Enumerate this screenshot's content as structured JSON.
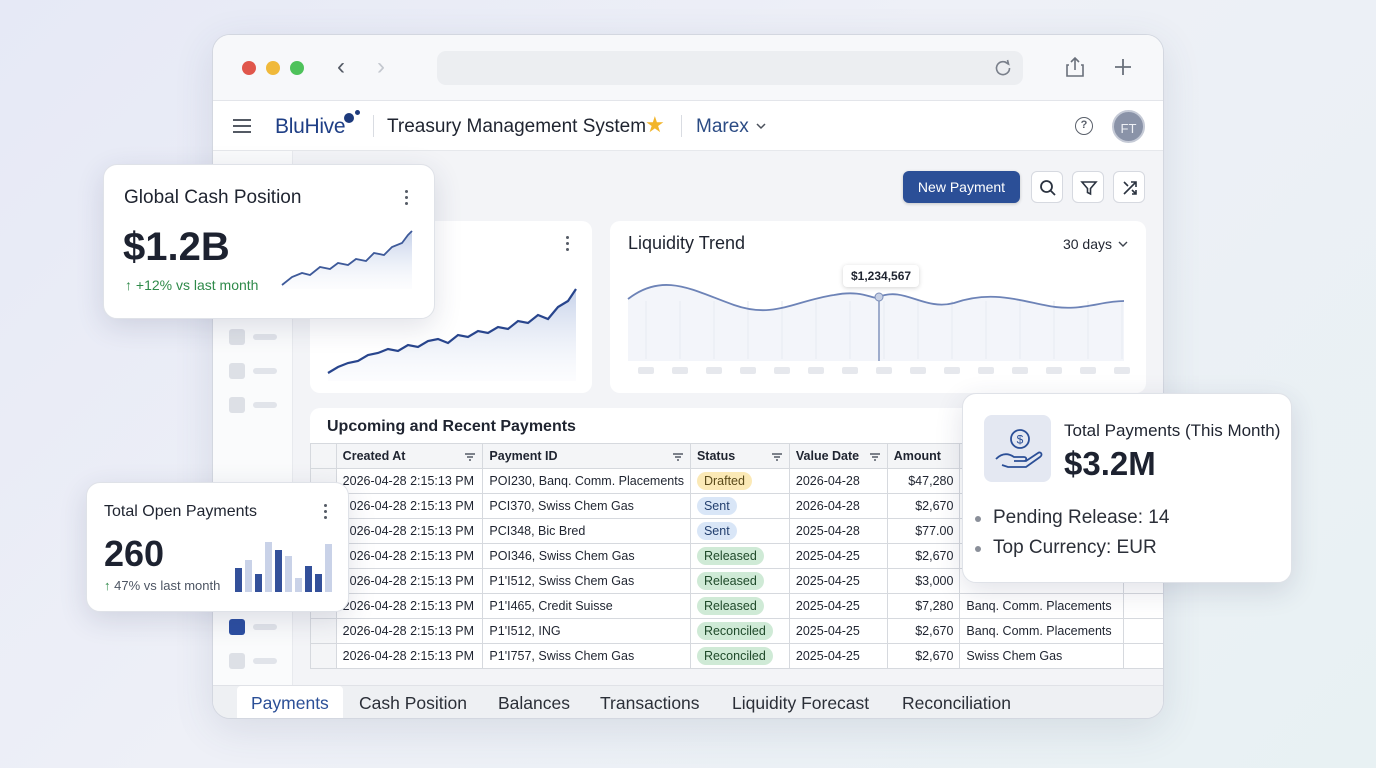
{
  "app": {
    "brand": "BluHive",
    "title": "Treasury Management System",
    "entity": "Marex",
    "avatar_initials": "FT",
    "help_glyph": "?"
  },
  "toolbar": {
    "new_payment_label": "New Payment"
  },
  "liquidity": {
    "title": "Liquidity Trend",
    "range": "30 days",
    "tooltip": "$1,234,567"
  },
  "table": {
    "title": "Upcoming and Recent Payments",
    "columns": [
      "Created At",
      "Payment ID",
      "Status",
      "Value Date",
      "Amount"
    ],
    "rows": [
      {
        "created": "2026-04-28 2:15:13 PM",
        "id": "POI230, Banq. Comm. Placements",
        "status": "Drafted",
        "value_date": "2026-04-28",
        "amount": "$47,280",
        "extra": ""
      },
      {
        "created": "2026-04-28 2:15:13 PM",
        "id": "PCI370, Swiss Chem Gas",
        "status": "Sent",
        "value_date": "2026-04-28",
        "amount": "$2,670",
        "extra": ""
      },
      {
        "created": "2026-04-28 2:15:13 PM",
        "id": "PCI348, Bic Bred",
        "status": "Sent",
        "value_date": "2025-04-28",
        "amount": "$77.00",
        "extra": ""
      },
      {
        "created": "2026-04-28 2:15:13 PM",
        "id": "POI346, Swiss Chem Gas",
        "status": "Released",
        "value_date": "2025-04-25",
        "amount": "$2,670",
        "extra": ""
      },
      {
        "created": "2026-04-28 2:15:13 PM",
        "id": "P1'I512, Swiss Chem Gas",
        "status": "Released",
        "value_date": "2025-04-25",
        "amount": "$3,000",
        "extra": ""
      },
      {
        "created": "2026-04-28 2:15:13 PM",
        "id": "P1'I465, Credit Suisse",
        "status": "Released",
        "value_date": "2025-04-25",
        "amount": "$7,280",
        "extra": "Banq. Comm. Placements"
      },
      {
        "created": "2026-04-28 2:15:13 PM",
        "id": "P1'I512, ING",
        "status": "Reconciled",
        "value_date": "2025-04-25",
        "amount": "$2,670",
        "extra": "Banq. Comm. Placements"
      },
      {
        "created": "2026-04-28 2:15:13 PM",
        "id": "P1'I757, Swiss Chem Gas",
        "status": "Reconciled",
        "value_date": "2025-04-25",
        "amount": "$2,670",
        "extra": "Swiss Chem Gas"
      }
    ]
  },
  "tabs": [
    "Payments",
    "Cash Position",
    "Balances",
    "Transactions",
    "Liquidity Forecast",
    "Reconciliation"
  ],
  "cash_card": {
    "title": "Global Cash Position",
    "value": "$1.2B",
    "delta": "+12% vs last month"
  },
  "open_card": {
    "title": "Total Open Payments",
    "value": "260",
    "delta": "47% vs last month"
  },
  "total_card": {
    "title": "Total Payments (This Month)",
    "value": "$3.2M",
    "bullets": [
      "Pending Release: 14",
      "Top Currency: EUR"
    ]
  },
  "colors": {
    "primary": "#2b4f97",
    "accent_star": "#f2b52a",
    "up": "#2f8a4a"
  },
  "icons": [
    "hamburger-icon",
    "star-icon",
    "chevron-down-icon",
    "help-icon",
    "search-icon",
    "filter-icon",
    "sort-icon",
    "share-icon",
    "plus-icon",
    "reload-icon",
    "money-hand-icon"
  ]
}
